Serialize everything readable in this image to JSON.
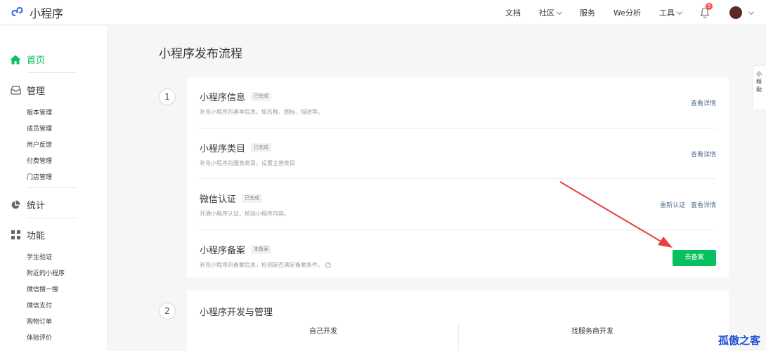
{
  "header": {
    "logo_text": "小程序",
    "nav": [
      "文档",
      "社区",
      "服务",
      "We分析",
      "工具"
    ],
    "notification_count": "5"
  },
  "sidebar": {
    "home": "首页",
    "manage": {
      "label": "管理",
      "items": [
        "版本管理",
        "成员管理",
        "用户反馈",
        "付费管理",
        "门店管理"
      ]
    },
    "stats": "统计",
    "features": {
      "label": "功能",
      "items": [
        "学生验证",
        "附近的小程序",
        "微信搜一搜",
        "微信支付",
        "购物订单",
        "体验评价"
      ]
    }
  },
  "main": {
    "title": "小程序发布流程",
    "step1": {
      "number": "1",
      "rows": [
        {
          "title": "小程序信息",
          "tag": "已完成",
          "desc": "补充小程序的基本信息，如名称、图标、描述等。",
          "links": [
            "查看详情"
          ]
        },
        {
          "title": "小程序类目",
          "tag": "已完成",
          "desc": "补充小程序的服务类目，设置主营类目",
          "links": [
            "查看详情"
          ]
        },
        {
          "title": "微信认证",
          "tag": "已完成",
          "desc": "开通小程序认证，核验小程序内容。",
          "links": [
            "重新认证",
            "查看详情"
          ]
        },
        {
          "title": "小程序备案",
          "tag": "未备案",
          "desc": "补充小程序的备案信息，检测是否满足备案条件。",
          "button": "去备案"
        }
      ]
    },
    "step2": {
      "number": "2",
      "title": "小程序开发与管理",
      "col_left": "自己开发",
      "col_right": "找服务商开发"
    }
  },
  "side_float": {
    "text": "小程助"
  },
  "watermark": "孤傲之客",
  "colors": {
    "accent": "#07c160",
    "link": "#576b95",
    "arrow": "#e8413c"
  }
}
